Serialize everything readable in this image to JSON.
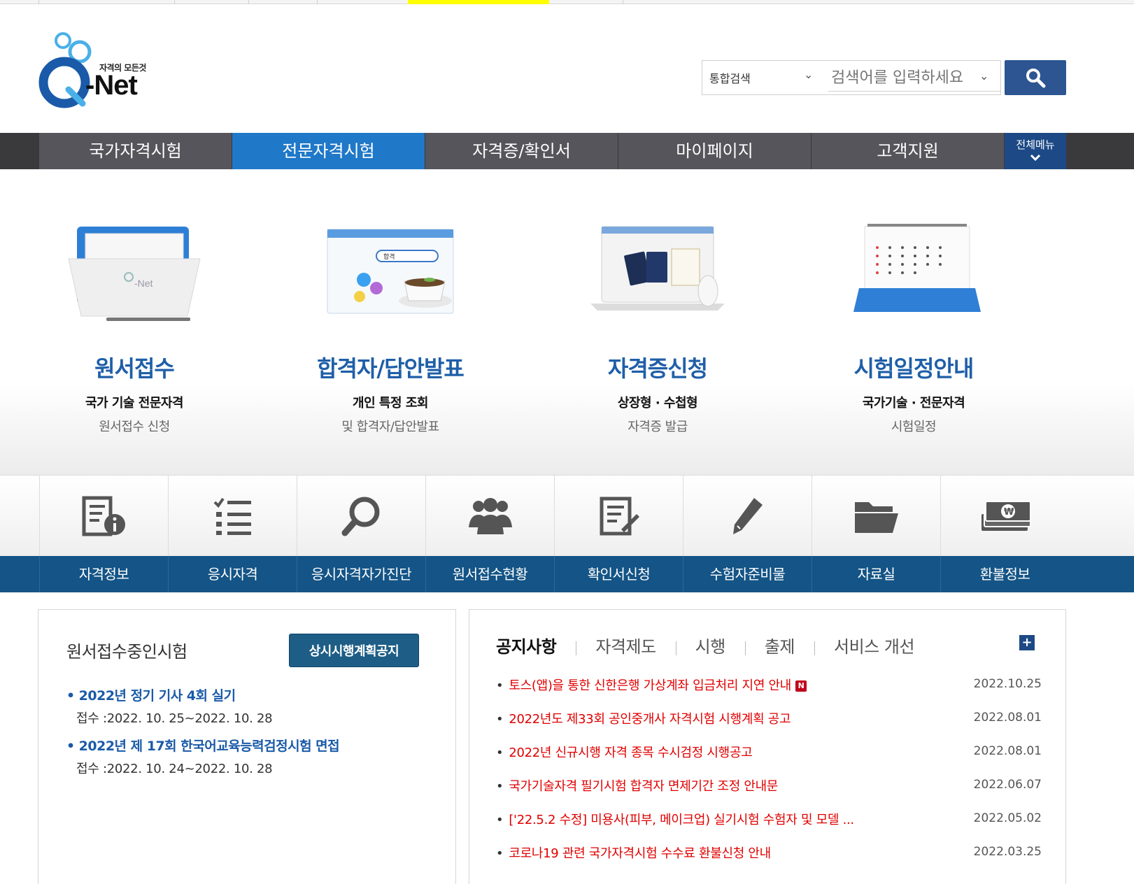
{
  "header": {
    "logo_tagline": "자격의 모든것",
    "logo_name": "-Net",
    "search_scope": "통합검색",
    "search_placeholder": "검색어를 입력하세요"
  },
  "gnb": {
    "items": [
      "국가자격시험",
      "전문자격시험",
      "자격증/확인서",
      "마이페이지",
      "고객지원"
    ],
    "active_index": 1,
    "all_menu": "전체메뉴"
  },
  "services": [
    {
      "title": "원서접수",
      "sub1": "국가 기술 전문자격",
      "sub2": "원서접수 신청",
      "icon": "folder-icon"
    },
    {
      "title": "합격자/답안발표",
      "sub1": "개인 특정 조회",
      "sub2": "및 합격자/답안발표",
      "icon": "browser-search-icon",
      "search_text": "합격"
    },
    {
      "title": "자격증신청",
      "sub1": "상장형 · 수첩형",
      "sub2": "자격증 발급",
      "icon": "laptop-certificate-icon"
    },
    {
      "title": "시험일정안내",
      "sub1": "국가기술 · 전문자격",
      "sub2": "시험일정",
      "icon": "calendar-icon"
    }
  ],
  "quick_menu": [
    {
      "label": "자격정보",
      "icon": "document-info-icon"
    },
    {
      "label": "응시자격",
      "icon": "checklist-icon"
    },
    {
      "label": "응시자격자가진단",
      "icon": "magnifier-icon"
    },
    {
      "label": "원서접수현황",
      "icon": "people-icon"
    },
    {
      "label": "확인서신청",
      "icon": "document-edit-icon"
    },
    {
      "label": "수험자준비물",
      "icon": "pencil-icon"
    },
    {
      "label": "자료실",
      "icon": "open-folder-icon"
    },
    {
      "label": "환불정보",
      "icon": "money-icon"
    }
  ],
  "exams_panel": {
    "title": "원서접수중인시험",
    "button": "상시시행계획공지",
    "exams": [
      {
        "name": "2022년 정기 기사 4회 실기",
        "period": "접수 :2022. 10. 25~2022. 10. 28"
      },
      {
        "name": "2022년 제 17회 한국어교육능력검정시험 면접",
        "period": "접수 :2022. 10. 24~2022. 10. 28"
      }
    ]
  },
  "notice_panel": {
    "tabs": [
      "공지사항",
      "자격제도",
      "시행",
      "출제",
      "서비스 개선"
    ],
    "more": "+",
    "new_badge": "N",
    "notices": [
      {
        "title": "토스(앱)을 통한 신한은행 가상계좌 입금처리 지연 안내",
        "date": "2022.10.25",
        "is_new": true
      },
      {
        "title": "2022년도 제33회 공인중개사 자격시험 시행계획 공고",
        "date": "2022.08.01"
      },
      {
        "title": "2022년 신규시행 자격 종목 수시검정 시행공고",
        "date": "2022.08.01"
      },
      {
        "title": "국가기술자격 필기시험 합격자 면제기간 조정 안내문",
        "date": "2022.06.07"
      },
      {
        "title": "['22.5.2 수정] 미용사(피부, 메이크업) 실기시험 수험자 및 모델 ...",
        "date": "2022.05.02"
      },
      {
        "title": "코로나19 관련 국가자격시험 수수료 환불신청 안내",
        "date": "2022.03.25"
      }
    ]
  },
  "colors": {
    "gnb_active": "#1f78c8",
    "service_title": "#1f5fa8",
    "quickbar": "#145486",
    "notice_text": "#e00000"
  }
}
